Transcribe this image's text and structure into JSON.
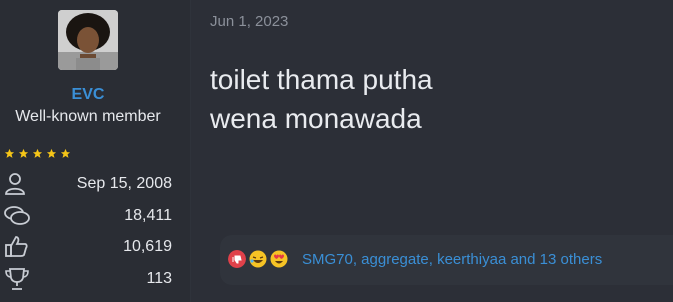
{
  "user": {
    "name": "EVC",
    "title": "Well-known member",
    "rating_stars": 5,
    "stats": [
      {
        "icon": "user-icon",
        "value": "Sep 15, 2008"
      },
      {
        "icon": "messages-icon",
        "value": "18,411"
      },
      {
        "icon": "thumbs-up-icon",
        "value": "10,619"
      },
      {
        "icon": "trophy-icon",
        "value": "113"
      }
    ]
  },
  "post": {
    "date": "Jun 1, 2023",
    "lines": [
      "toilet thama putha",
      "wena monawada"
    ]
  },
  "reactions": {
    "icons": [
      "dislike-icon",
      "laughing-icon",
      "heart-eyes-icon"
    ],
    "users_text": "SMG70, aggregate, keerthiyaa and 13 others"
  },
  "colors": {
    "background": "#2c2f37",
    "link": "#3a8fd6",
    "star": "#f5c518",
    "muted": "#8b909a"
  }
}
